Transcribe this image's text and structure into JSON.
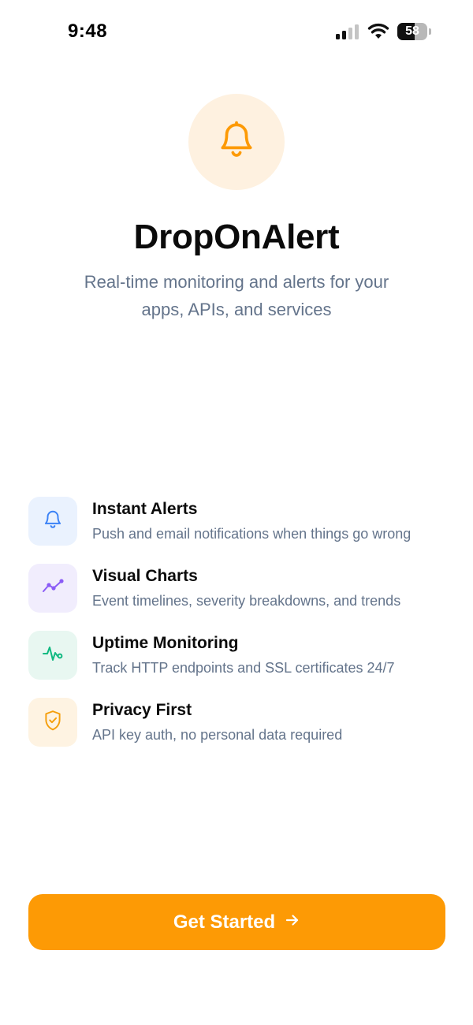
{
  "status_bar": {
    "time": "9:48",
    "battery_percent": "58",
    "battery_level": 0.58,
    "signal_bars_active": 2,
    "signal_bars_total": 4
  },
  "hero": {
    "icon": "bell-icon",
    "title": "DropOnAlert",
    "subtitle": "Real-time monitoring and alerts for your apps, APIs, and services",
    "accent_color": "#fd9a05",
    "icon_bg": "#fef1e0"
  },
  "features": [
    {
      "icon": "bell-icon",
      "title": "Instant Alerts",
      "description": "Push and email notifications when things go wrong",
      "icon_color": "#3b82f6",
      "bg_color": "#eaf2fe"
    },
    {
      "icon": "trend-chart-icon",
      "title": "Visual Charts",
      "description": "Event timelines, severity breakdowns, and trends",
      "icon_color": "#8b5cf6",
      "bg_color": "#f1edfd"
    },
    {
      "icon": "pulse-icon",
      "title": "Uptime Monitoring",
      "description": "Track HTTP endpoints and SSL certificates 24/7",
      "icon_color": "#10b981",
      "bg_color": "#e8f7f1"
    },
    {
      "icon": "shield-check-icon",
      "title": "Privacy First",
      "description": "API key auth, no personal data required",
      "icon_color": "#f59e0b",
      "bg_color": "#fef3e2"
    }
  ],
  "cta": {
    "label": "Get Started",
    "icon": "arrow-right-icon",
    "color": "#fd9a05"
  }
}
